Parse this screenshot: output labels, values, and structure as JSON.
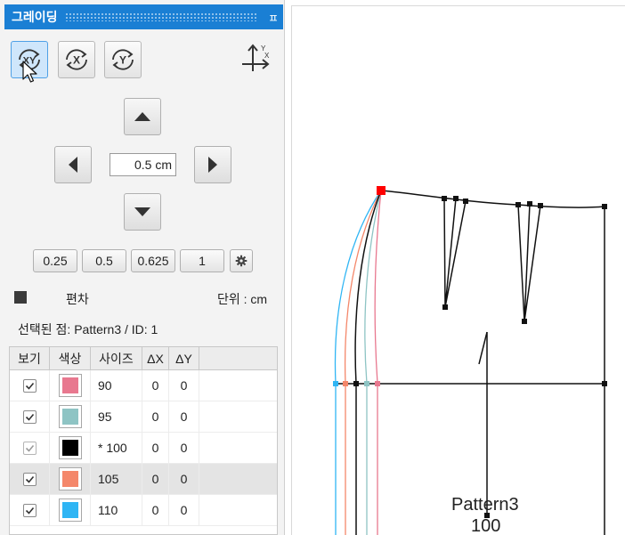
{
  "panel": {
    "title": "그레이딩",
    "pin_glyph": "ㅍ",
    "axis_buttons": [
      {
        "label": "XY",
        "icon": "xy-rotate-icon",
        "active": true
      },
      {
        "label": "X",
        "icon": "x-rotate-icon",
        "active": false
      },
      {
        "label": "Y",
        "icon": "y-rotate-icon",
        "active": false
      }
    ],
    "axes_icon": {
      "x": "X",
      "y": "Y"
    },
    "step": {
      "value": "0.5 cm"
    },
    "presets": [
      "0.25",
      "0.5",
      "0.625",
      "1"
    ],
    "deviation_label": "편차",
    "unit_label": "단위 : cm",
    "selected_point": "선택된 점: Pattern3 / ID: 1",
    "table": {
      "headers": [
        "보기",
        "색상",
        "사이즈",
        "ΔX",
        "ΔY"
      ],
      "rows": [
        {
          "visible": true,
          "color": "#e8788f",
          "size": "90",
          "dx": "0",
          "dy": "0"
        },
        {
          "visible": true,
          "color": "#8ec4c4",
          "size": "95",
          "dx": "0",
          "dy": "0"
        },
        {
          "visible": true,
          "color": "#000000",
          "size": "* 100",
          "dx": "0",
          "dy": "0"
        },
        {
          "visible": true,
          "color": "#f4876a",
          "size": "105",
          "dx": "0",
          "dy": "0"
        },
        {
          "visible": true,
          "color": "#2fb5f4",
          "size": "110",
          "dx": "0",
          "dy": "0"
        }
      ]
    }
  },
  "canvas": {
    "pattern_name": "Pattern3",
    "pattern_size": "100"
  },
  "colors": {
    "accent": "#1a7fd4",
    "selected_point": "#ff0000"
  }
}
